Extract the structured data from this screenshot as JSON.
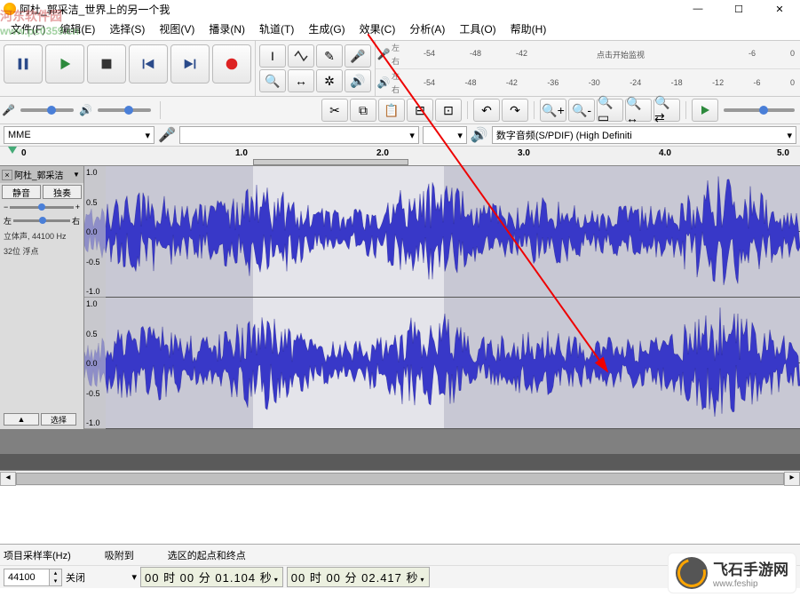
{
  "title": "阿杜_郭采洁_世界上的另一个我",
  "watermark": {
    "text": "河东软件园",
    "url": "www.pc0359.cn"
  },
  "menu": {
    "file": "文件(F)",
    "edit": "编辑(E)",
    "select": "选择(S)",
    "view": "视图(V)",
    "transport": "播录(N)",
    "tracks": "轨道(T)",
    "generate": "生成(G)",
    "effect": "效果(C)",
    "analyze": "分析(A)",
    "tools": "工具(O)",
    "help": "帮助(H)"
  },
  "meters": {
    "rec": {
      "lr": [
        "左",
        "右"
      ],
      "ticks": [
        "-54",
        "-48",
        "-42",
        "",
        "点击开始监视",
        "",
        "",
        "-6",
        "0"
      ]
    },
    "play": {
      "lr": [
        "左",
        "右"
      ],
      "ticks": [
        "-54",
        "-48",
        "-42",
        "-36",
        "-30",
        "-24",
        "-18",
        "-12",
        "-6",
        "0"
      ]
    }
  },
  "devices": {
    "host": "MME",
    "output": "数字音频(S/PDIF) (High Definiti"
  },
  "ruler": {
    "ticks": [
      "0",
      "1.0",
      "2.0",
      "3.0",
      "4.0",
      "5.0"
    ]
  },
  "track": {
    "name": "阿杜_郭采洁",
    "mute": "静音",
    "solo": "独奏",
    "pan_l": "左",
    "pan_r": "右",
    "info1": "立体声, 44100 Hz",
    "info2": "32位 浮点",
    "collapse": "▲",
    "select": "选择"
  },
  "wave_labels": [
    "1.0",
    "0.5",
    "0.0",
    "-0.5",
    "-1.0"
  ],
  "status": {
    "srate_lbl": "项目采样率(Hz)",
    "srate": "44100",
    "snap_lbl": "吸附到",
    "snap": "关闭",
    "sel_lbl": "选区的起点和终点",
    "t1": "00 时 00 分 01.104 秒",
    "t2": "00 时 00 分 02.417 秒"
  },
  "brand": {
    "name": "飞石手游网",
    "url": "www.feship"
  }
}
